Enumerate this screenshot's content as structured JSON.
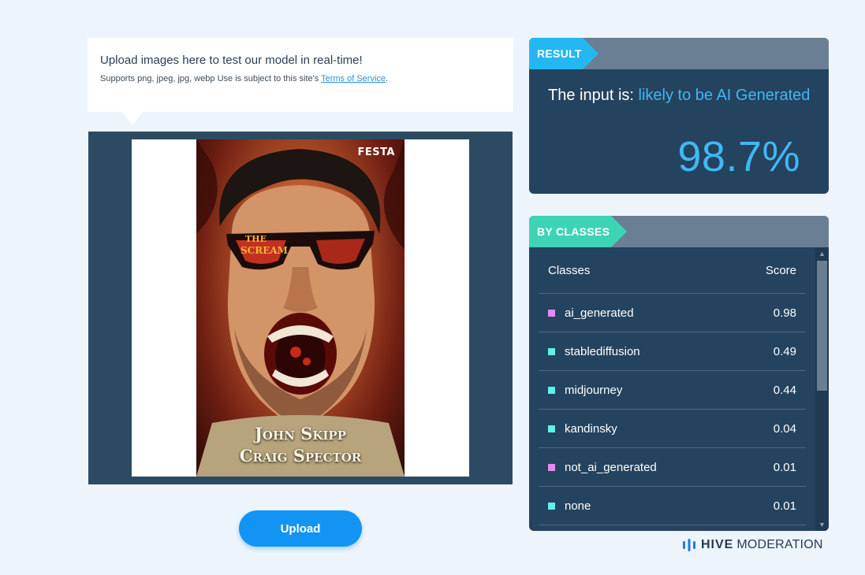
{
  "upload_prompt": {
    "title": "Upload images here to test our model in real-time!",
    "subtitle": "Supports png, jpeg, jpg, webp Use is subject to this site's ",
    "tos_link": "Terms of Service",
    "tos_period": "."
  },
  "preview": {
    "poster": {
      "publisher": "FESTA",
      "overlay_text": "THE SCREAM",
      "author_line1": "John Skipp",
      "author_line2": "Craig Spector"
    }
  },
  "upload_button": {
    "label": "Upload"
  },
  "result": {
    "header": "RESULT",
    "prefix": "The input is: ",
    "verdict": "likely to be AI Generated",
    "score": "98.7%",
    "header_accent": "#25b7f3"
  },
  "classes": {
    "header": "BY CLASSES",
    "col_classes": "Classes",
    "col_score": "Score",
    "header_accent": "#3dd4b5",
    "rows": [
      {
        "name": "ai_generated",
        "score": "0.98",
        "color": "#e08cf0"
      },
      {
        "name": "stablediffusion",
        "score": "0.49",
        "color": "#5ff0ea"
      },
      {
        "name": "midjourney",
        "score": "0.44",
        "color": "#5ff0ea"
      },
      {
        "name": "kandinsky",
        "score": "0.04",
        "color": "#5ff0ea"
      },
      {
        "name": "not_ai_generated",
        "score": "0.01",
        "color": "#e08cf0"
      },
      {
        "name": "none",
        "score": "0.01",
        "color": "#5ff0ea"
      }
    ]
  },
  "brand": {
    "strong": "HIVE",
    "light": "MODERATION",
    "icon": "hive-logo-icon"
  }
}
